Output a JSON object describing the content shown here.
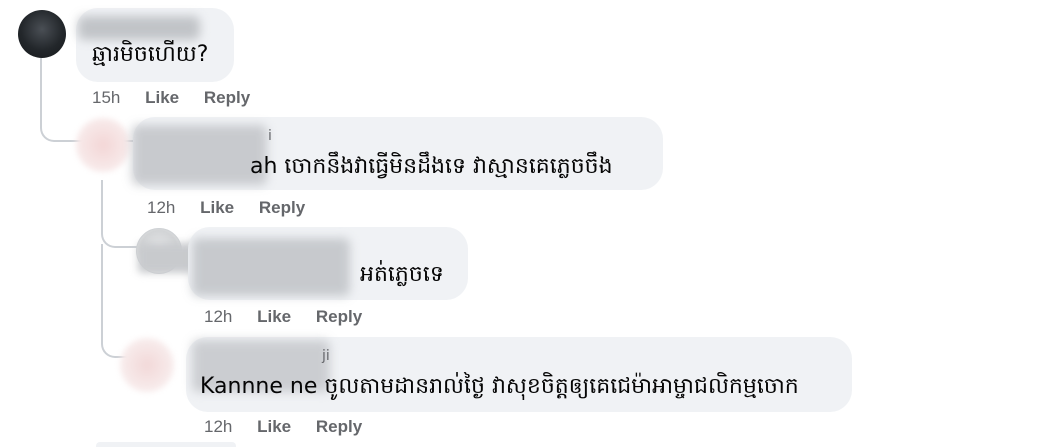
{
  "comments": [
    {
      "text": "ឆ្មារមិចហើយ?",
      "time": "15h",
      "like_label": "Like",
      "reply_label": "Reply"
    },
    {
      "text": "ah ចោកនឹងវាធ្វើមិនដឹងទេ វាស្មានគេភ្លេចចឹង",
      "name_fragment": "i",
      "time": "12h",
      "like_label": "Like",
      "reply_label": "Reply"
    },
    {
      "text": "អត់ភ្លេចទេ",
      "time": "12h",
      "like_label": "Like",
      "reply_label": "Reply"
    },
    {
      "text": "Kannne ne ចូលតាមដានរាល់ថ្ងៃ វាសុខចិត្តឲ្យគេជេម៉ាអាម្ចាជលិកម្មចោក",
      "name_fragment": "ji",
      "time": "12h",
      "like_label": "Like",
      "reply_label": "Reply"
    }
  ]
}
